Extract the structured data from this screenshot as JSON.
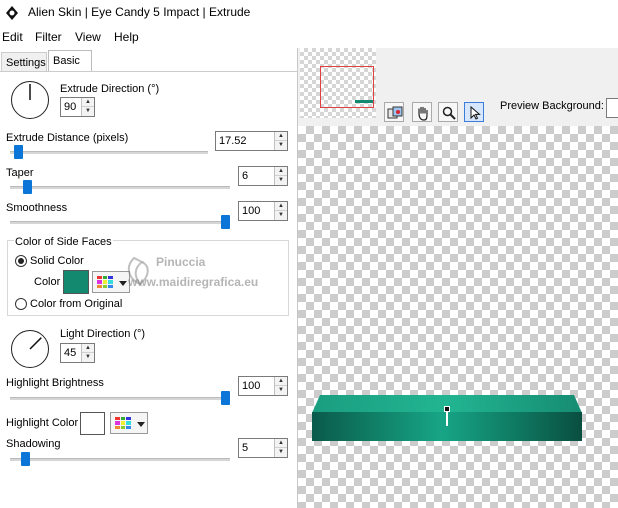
{
  "window": {
    "title": "Alien Skin | Eye Candy 5 Impact | Extrude"
  },
  "menu": [
    "Edit",
    "Filter",
    "View",
    "Help"
  ],
  "tabs": [
    {
      "label": "Settings",
      "active": false
    },
    {
      "label": "Basic",
      "active": true
    }
  ],
  "basic": {
    "extrude_direction": {
      "label": "Extrude Direction (°)",
      "value": "90",
      "angle_deg": 90
    },
    "extrude_distance": {
      "label": "Extrude Distance (pixels)",
      "value": "17.52",
      "slider_fraction": 0.02
    },
    "taper": {
      "label": "Taper",
      "value": "6",
      "slider_fraction": 0.06
    },
    "smoothness": {
      "label": "Smoothness",
      "value": "100",
      "slider_fraction": 1.0
    },
    "side_faces": {
      "group_label": "Color of Side Faces",
      "solid_color_label": "Solid Color",
      "color_label": "Color",
      "color_value": "#138a6f",
      "from_original_label": "Color from Original",
      "selected": "solid"
    },
    "light_direction": {
      "label": "Light Direction (°)",
      "value": "45",
      "angle_deg": 45
    },
    "highlight_brightness": {
      "label": "Highlight Brightness",
      "value": "100",
      "slider_fraction": 1.0
    },
    "highlight_color": {
      "label": "Highlight Color",
      "color_value": "#ffffff"
    },
    "shadowing": {
      "label": "Shadowing",
      "value": "5",
      "slider_fraction": 0.05
    }
  },
  "preview": {
    "background_label": "Preview Background:",
    "tools": [
      "preview-toggle-icon",
      "hand-icon",
      "zoom-icon",
      "arrow-icon"
    ],
    "active_tool": "arrow-icon"
  },
  "watermark": {
    "line1": "Pinuccia",
    "line2": "www.maidiregrafica.eu"
  },
  "colors": {
    "accent": "#0b76d8",
    "extrude_green": "#138a6f"
  }
}
